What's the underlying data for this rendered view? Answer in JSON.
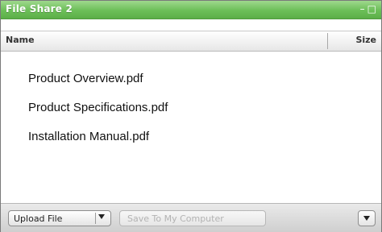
{
  "window": {
    "title": "File Share 2",
    "minimize_glyph": "–",
    "maximize_glyph": "□"
  },
  "columns": {
    "name": "Name",
    "size": "Size"
  },
  "files": [
    {
      "name": "Product Overview.pdf",
      "size": ""
    },
    {
      "name": "Product Specifications.pdf",
      "size": ""
    },
    {
      "name": "Installation Manual.pdf",
      "size": ""
    }
  ],
  "toolbar": {
    "upload_label": "Upload File",
    "save_label": "Save To My Computer"
  },
  "icons": {
    "minimize": "minimize-icon",
    "maximize": "maximize-icon",
    "dropdown": "chevron-down-icon"
  },
  "colors": {
    "titlebar": "#6cbf58",
    "title_text": "#ffffff",
    "disabled_text": "#b3b3b3"
  }
}
